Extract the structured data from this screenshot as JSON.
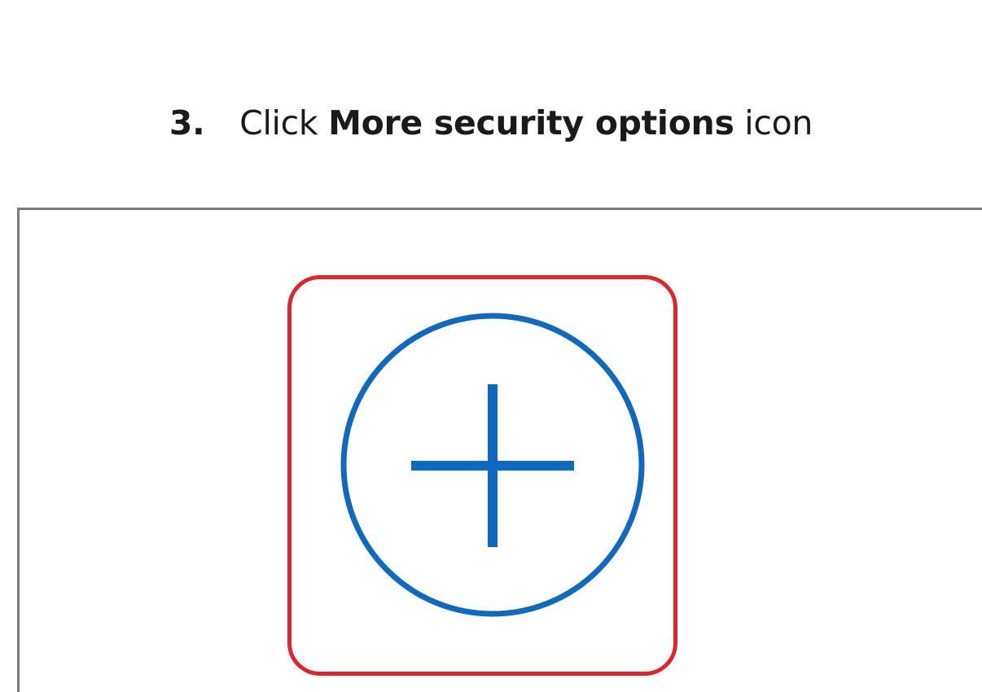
{
  "instruction": {
    "step_number": "3.",
    "prefix": "Click",
    "target": "More security options",
    "suffix": "icon"
  },
  "icon": {
    "name": "plus-circle-icon",
    "stroke_color": "#0f6abf",
    "highlight_color": "#e0242c"
  }
}
